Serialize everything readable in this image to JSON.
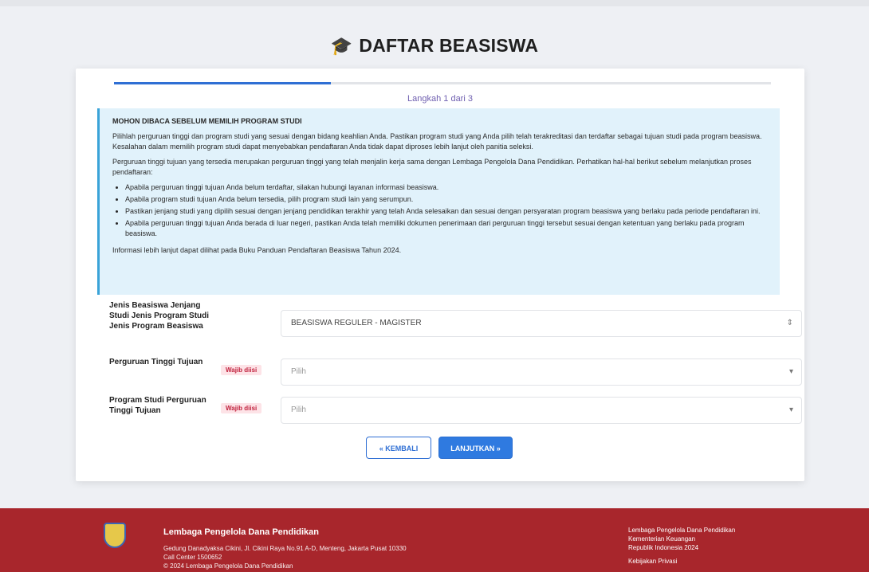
{
  "page": {
    "title": "DAFTAR BEASISWA"
  },
  "wizard": {
    "progress_percent": 33,
    "step_label": "Langkah 1 dari 3"
  },
  "notice": {
    "heading": "MOHON DIBACA SEBELUM MEMILIH PROGRAM STUDI",
    "intro": "Pilihlah perguruan tinggi dan program studi yang sesuai dengan bidang keahlian Anda. Pastikan program studi yang Anda pilih telah terakreditasi dan terdaftar sebagai tujuan studi pada program beasiswa. Kesalahan dalam memilih program studi dapat menyebabkan pendaftaran Anda tidak dapat diproses lebih lanjut oleh panitia seleksi.",
    "para2": "Perguruan tinggi tujuan yang tersedia merupakan perguruan tinggi yang telah menjalin kerja sama dengan Lembaga Pengelola Dana Pendidikan. Perhatikan hal-hal berikut sebelum melanjutkan proses pendaftaran:",
    "bullets": [
      "Apabila perguruan tinggi tujuan Anda belum terdaftar, silakan hubungi layanan informasi beasiswa.",
      "Apabila program studi tujuan Anda belum tersedia, pilih program studi lain yang serumpun.",
      "Pastikan jenjang studi yang dipilih sesuai dengan jenjang pendidikan terakhir yang telah Anda selesaikan dan sesuai dengan persyaratan program beasiswa yang berlaku pada periode pendaftaran ini.",
      "Apabila perguruan tinggi tujuan Anda berada di luar negeri, pastikan Anda telah memiliki dokumen penerimaan dari perguruan tinggi tersebut sesuai dengan ketentuan yang berlaku pada program beasiswa."
    ],
    "closing": "Informasi lebih lanjut dapat dilihat pada Buku Panduan Pendaftaran Beasiswa Tahun 2024."
  },
  "form": {
    "row1": {
      "label": "Jenis Beasiswa Jenjang Studi Jenis Program Studi Jenis Program Beasiswa",
      "value": "BEASISWA REGULER - MAGISTER"
    },
    "row2": {
      "label": "Perguruan Tinggi Tujuan",
      "badge": "Wajib diisi",
      "placeholder": "Pilih"
    },
    "row3": {
      "label": "Program Studi Perguruan Tinggi Tujuan",
      "badge": "Wajib diisi",
      "placeholder": "Pilih"
    }
  },
  "buttons": {
    "back": "« KEMBALI",
    "next": "LANJUTKAN »"
  },
  "footer": {
    "org": "Lembaga Pengelola Dana Pendidikan",
    "address_lines": [
      "Gedung Danadyaksa Cikini, Jl. Cikini Raya No.91 A-D, Menteng, Jakarta Pusat 10330",
      "Call Center 1500652",
      "© 2024 Lembaga Pengelola Dana Pendidikan"
    ],
    "right_lines": [
      "Lembaga Pengelola Dana Pendidikan",
      "Kementerian Keuangan",
      "Republik Indonesia 2024",
      "Kebijakan Privasi"
    ]
  },
  "colors": {
    "primary": "#2f6fd4",
    "footer_bg": "#a8262c",
    "notice_bg": "#e1f2fb",
    "badge_red": "#c0213d"
  }
}
